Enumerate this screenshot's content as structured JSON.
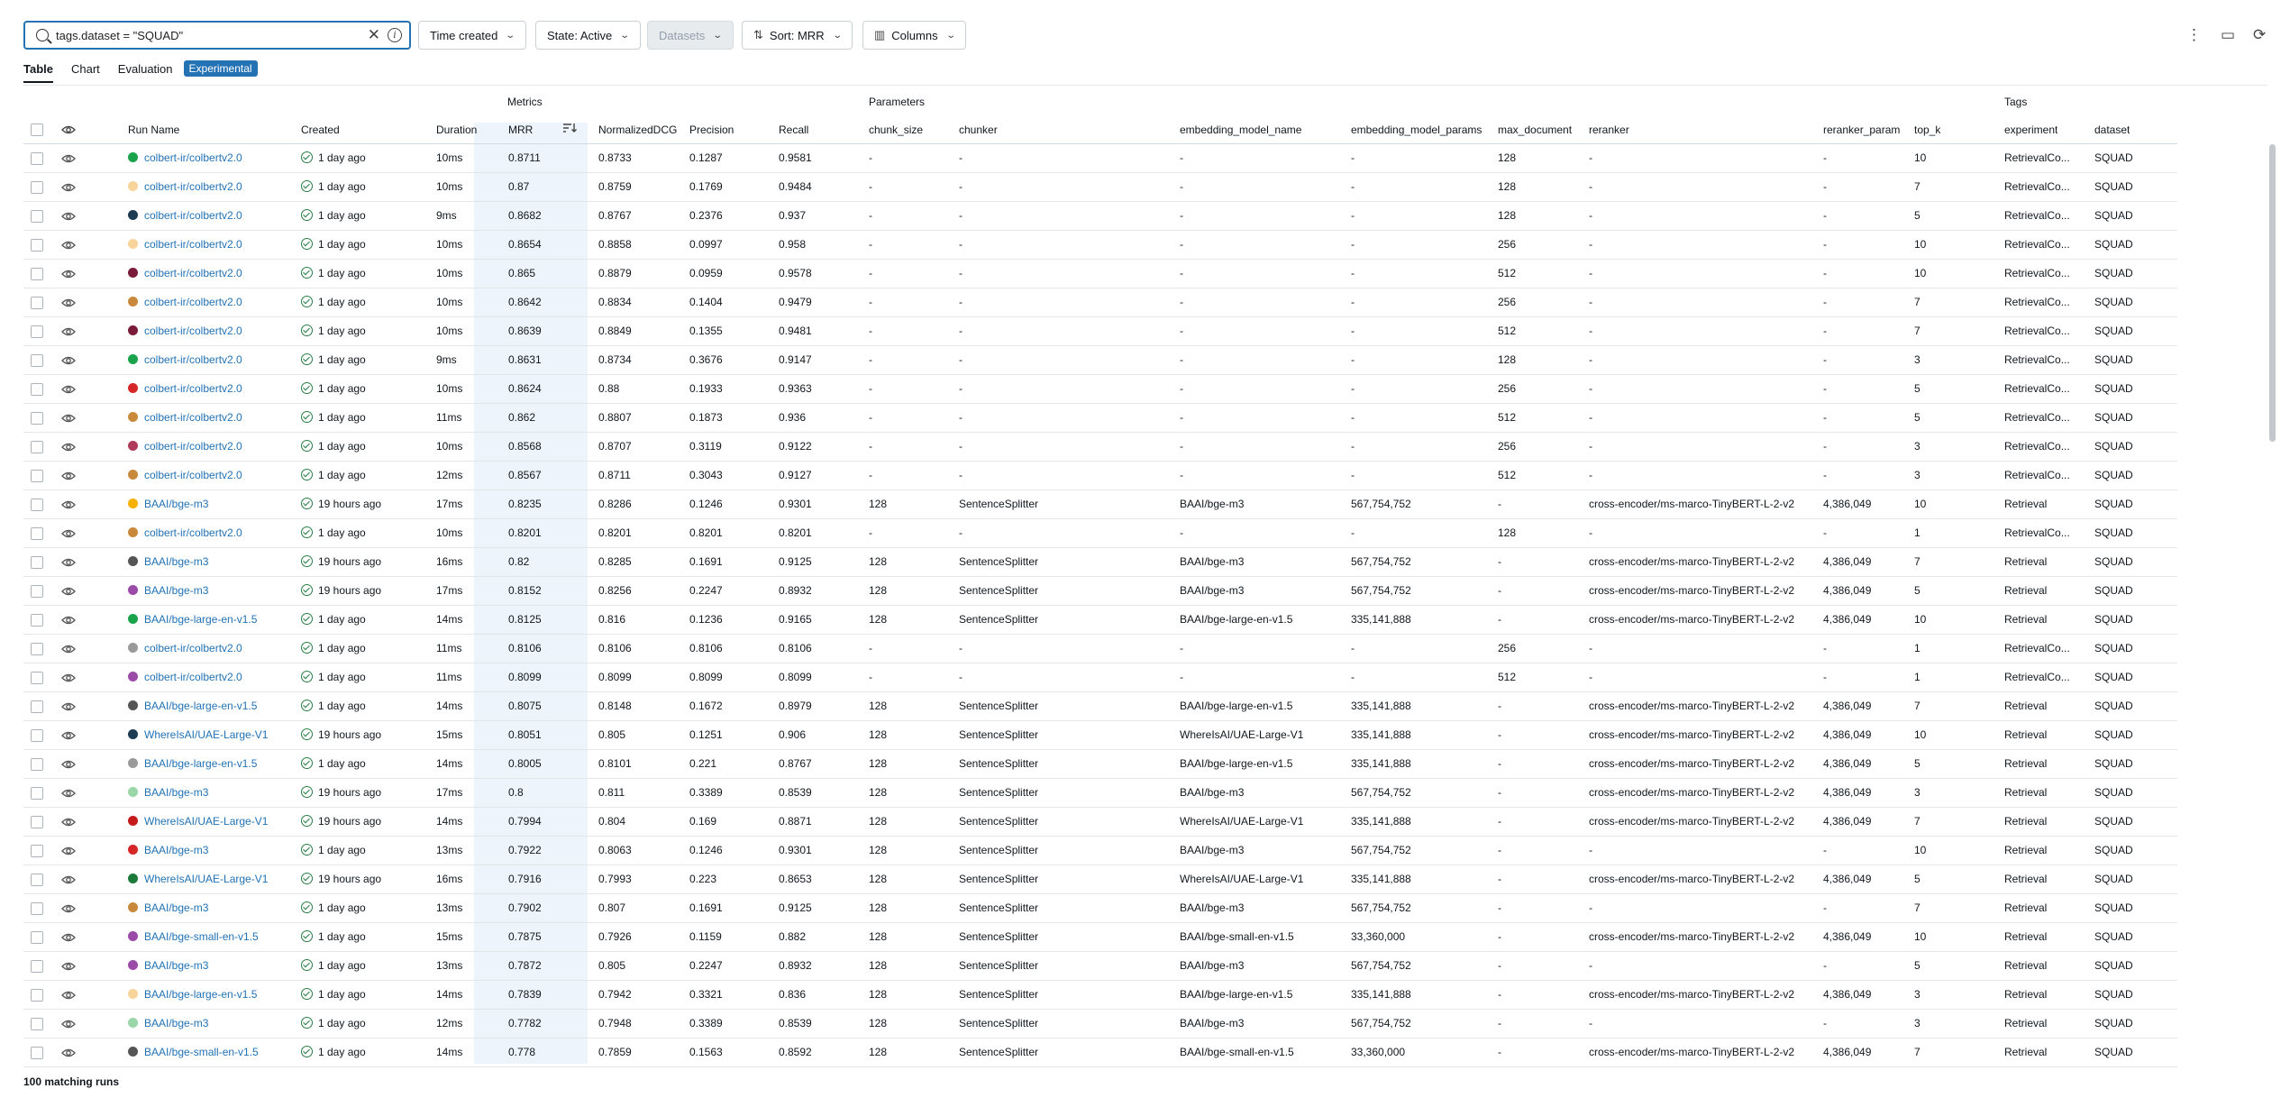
{
  "toolbar": {
    "search_value": "tags.dataset = \"SQUAD\"",
    "time_created": "Time created",
    "state": "State: Active",
    "datasets": "Datasets",
    "sort": "Sort: MRR",
    "columns": "Columns"
  },
  "tabs": {
    "table": "Table",
    "chart": "Chart",
    "evaluation": "Evaluation",
    "experimental": "Experimental"
  },
  "groups": {
    "metrics": "Metrics",
    "parameters": "Parameters",
    "tags": "Tags"
  },
  "columns": {
    "run_name": "Run Name",
    "created": "Created",
    "duration": "Duration",
    "mrr": "MRR",
    "ndcg": "NormalizedDCG",
    "precision": "Precision",
    "recall": "Recall",
    "chunk_size": "chunk_size",
    "chunker": "chunker",
    "embedding_model_name": "embedding_model_name",
    "embedding_model_params": "embedding_model_params",
    "max_document": "max_document",
    "reranker": "reranker",
    "reranker_param": "reranker_param",
    "top_k": "top_k",
    "experiment": "experiment",
    "dataset": "dataset"
  },
  "colors": {
    "link": "#2272b4",
    "success": "#277c43"
  },
  "rows": [
    {
      "color": "#1aa34a",
      "run": "colbert-ir/colbertv2.0",
      "created": "1 day ago",
      "duration": "10ms",
      "mrr": "0.8711",
      "ndcg": "0.8733",
      "precision": "0.1287",
      "recall": "0.9581",
      "chunk_size": "-",
      "chunker": "-",
      "emb_name": "-",
      "emb_params": "-",
      "max_doc": "128",
      "reranker": "-",
      "rr_param": "-",
      "top_k": "10",
      "experiment": "RetrievalCo...",
      "dataset": "SQUAD"
    },
    {
      "color": "#f8d49a",
      "run": "colbert-ir/colbertv2.0",
      "created": "1 day ago",
      "duration": "10ms",
      "mrr": "0.87",
      "ndcg": "0.8759",
      "precision": "0.1769",
      "recall": "0.9484",
      "chunk_size": "-",
      "chunker": "-",
      "emb_name": "-",
      "emb_params": "-",
      "max_doc": "128",
      "reranker": "-",
      "rr_param": "-",
      "top_k": "7",
      "experiment": "RetrievalCo...",
      "dataset": "SQUAD"
    },
    {
      "color": "#1d3b52",
      "run": "colbert-ir/colbertv2.0",
      "created": "1 day ago",
      "duration": "9ms",
      "mrr": "0.8682",
      "ndcg": "0.8767",
      "precision": "0.2376",
      "recall": "0.937",
      "chunk_size": "-",
      "chunker": "-",
      "emb_name": "-",
      "emb_params": "-",
      "max_doc": "128",
      "reranker": "-",
      "rr_param": "-",
      "top_k": "5",
      "experiment": "RetrievalCo...",
      "dataset": "SQUAD"
    },
    {
      "color": "#f8d49a",
      "run": "colbert-ir/colbertv2.0",
      "created": "1 day ago",
      "duration": "10ms",
      "mrr": "0.8654",
      "ndcg": "0.8858",
      "precision": "0.0997",
      "recall": "0.958",
      "chunk_size": "-",
      "chunker": "-",
      "emb_name": "-",
      "emb_params": "-",
      "max_doc": "256",
      "reranker": "-",
      "rr_param": "-",
      "top_k": "10",
      "experiment": "RetrievalCo...",
      "dataset": "SQUAD"
    },
    {
      "color": "#7a1b3a",
      "run": "colbert-ir/colbertv2.0",
      "created": "1 day ago",
      "duration": "10ms",
      "mrr": "0.865",
      "ndcg": "0.8879",
      "precision": "0.0959",
      "recall": "0.9578",
      "chunk_size": "-",
      "chunker": "-",
      "emb_name": "-",
      "emb_params": "-",
      "max_doc": "512",
      "reranker": "-",
      "rr_param": "-",
      "top_k": "10",
      "experiment": "RetrievalCo...",
      "dataset": "SQUAD"
    },
    {
      "color": "#c88a3a",
      "run": "colbert-ir/colbertv2.0",
      "created": "1 day ago",
      "duration": "10ms",
      "mrr": "0.8642",
      "ndcg": "0.8834",
      "precision": "0.1404",
      "recall": "0.9479",
      "chunk_size": "-",
      "chunker": "-",
      "emb_name": "-",
      "emb_params": "-",
      "max_doc": "256",
      "reranker": "-",
      "rr_param": "-",
      "top_k": "7",
      "experiment": "RetrievalCo...",
      "dataset": "SQUAD"
    },
    {
      "color": "#7a1b3a",
      "run": "colbert-ir/colbertv2.0",
      "created": "1 day ago",
      "duration": "10ms",
      "mrr": "0.8639",
      "ndcg": "0.8849",
      "precision": "0.1355",
      "recall": "0.9481",
      "chunk_size": "-",
      "chunker": "-",
      "emb_name": "-",
      "emb_params": "-",
      "max_doc": "512",
      "reranker": "-",
      "rr_param": "-",
      "top_k": "7",
      "experiment": "RetrievalCo...",
      "dataset": "SQUAD"
    },
    {
      "color": "#1aa34a",
      "run": "colbert-ir/colbertv2.0",
      "created": "1 day ago",
      "duration": "9ms",
      "mrr": "0.8631",
      "ndcg": "0.8734",
      "precision": "0.3676",
      "recall": "0.9147",
      "chunk_size": "-",
      "chunker": "-",
      "emb_name": "-",
      "emb_params": "-",
      "max_doc": "128",
      "reranker": "-",
      "rr_param": "-",
      "top_k": "3",
      "experiment": "RetrievalCo...",
      "dataset": "SQUAD"
    },
    {
      "color": "#d62728",
      "run": "colbert-ir/colbertv2.0",
      "created": "1 day ago",
      "duration": "10ms",
      "mrr": "0.8624",
      "ndcg": "0.88",
      "precision": "0.1933",
      "recall": "0.9363",
      "chunk_size": "-",
      "chunker": "-",
      "emb_name": "-",
      "emb_params": "-",
      "max_doc": "256",
      "reranker": "-",
      "rr_param": "-",
      "top_k": "5",
      "experiment": "RetrievalCo...",
      "dataset": "SQUAD"
    },
    {
      "color": "#c88a3a",
      "run": "colbert-ir/colbertv2.0",
      "created": "1 day ago",
      "duration": "11ms",
      "mrr": "0.862",
      "ndcg": "0.8807",
      "precision": "0.1873",
      "recall": "0.936",
      "chunk_size": "-",
      "chunker": "-",
      "emb_name": "-",
      "emb_params": "-",
      "max_doc": "512",
      "reranker": "-",
      "rr_param": "-",
      "top_k": "5",
      "experiment": "RetrievalCo...",
      "dataset": "SQUAD"
    },
    {
      "color": "#b03a5a",
      "run": "colbert-ir/colbertv2.0",
      "created": "1 day ago",
      "duration": "10ms",
      "mrr": "0.8568",
      "ndcg": "0.8707",
      "precision": "0.3119",
      "recall": "0.9122",
      "chunk_size": "-",
      "chunker": "-",
      "emb_name": "-",
      "emb_params": "-",
      "max_doc": "256",
      "reranker": "-",
      "rr_param": "-",
      "top_k": "3",
      "experiment": "RetrievalCo...",
      "dataset": "SQUAD"
    },
    {
      "color": "#c88a3a",
      "run": "colbert-ir/colbertv2.0",
      "created": "1 day ago",
      "duration": "12ms",
      "mrr": "0.8567",
      "ndcg": "0.8711",
      "precision": "0.3043",
      "recall": "0.9127",
      "chunk_size": "-",
      "chunker": "-",
      "emb_name": "-",
      "emb_params": "-",
      "max_doc": "512",
      "reranker": "-",
      "rr_param": "-",
      "top_k": "3",
      "experiment": "RetrievalCo...",
      "dataset": "SQUAD"
    },
    {
      "color": "#f5b000",
      "run": "BAAI/bge-m3",
      "created": "19 hours ago",
      "duration": "17ms",
      "mrr": "0.8235",
      "ndcg": "0.8286",
      "precision": "0.1246",
      "recall": "0.9301",
      "chunk_size": "128",
      "chunker": "SentenceSplitter",
      "emb_name": "BAAI/bge-m3",
      "emb_params": "567,754,752",
      "max_doc": "-",
      "reranker": "cross-encoder/ms-marco-TinyBERT-L-2-v2",
      "rr_param": "4,386,049",
      "top_k": "10",
      "experiment": "Retrieval",
      "dataset": "SQUAD"
    },
    {
      "color": "#c88a3a",
      "run": "colbert-ir/colbertv2.0",
      "created": "1 day ago",
      "duration": "10ms",
      "mrr": "0.8201",
      "ndcg": "0.8201",
      "precision": "0.8201",
      "recall": "0.8201",
      "chunk_size": "-",
      "chunker": "-",
      "emb_name": "-",
      "emb_params": "-",
      "max_doc": "128",
      "reranker": "-",
      "rr_param": "-",
      "top_k": "1",
      "experiment": "RetrievalCo...",
      "dataset": "SQUAD"
    },
    {
      "color": "#555555",
      "run": "BAAI/bge-m3",
      "created": "19 hours ago",
      "duration": "16ms",
      "mrr": "0.82",
      "ndcg": "0.8285",
      "precision": "0.1691",
      "recall": "0.9125",
      "chunk_size": "128",
      "chunker": "SentenceSplitter",
      "emb_name": "BAAI/bge-m3",
      "emb_params": "567,754,752",
      "max_doc": "-",
      "reranker": "cross-encoder/ms-marco-TinyBERT-L-2-v2",
      "rr_param": "4,386,049",
      "top_k": "7",
      "experiment": "Retrieval",
      "dataset": "SQUAD"
    },
    {
      "color": "#9b4aa8",
      "run": "BAAI/bge-m3",
      "created": "19 hours ago",
      "duration": "17ms",
      "mrr": "0.8152",
      "ndcg": "0.8256",
      "precision": "0.2247",
      "recall": "0.8932",
      "chunk_size": "128",
      "chunker": "SentenceSplitter",
      "emb_name": "BAAI/bge-m3",
      "emb_params": "567,754,752",
      "max_doc": "-",
      "reranker": "cross-encoder/ms-marco-TinyBERT-L-2-v2",
      "rr_param": "4,386,049",
      "top_k": "5",
      "experiment": "Retrieval",
      "dataset": "SQUAD"
    },
    {
      "color": "#1aa34a",
      "run": "BAAI/bge-large-en-v1.5",
      "created": "1 day ago",
      "duration": "14ms",
      "mrr": "0.8125",
      "ndcg": "0.816",
      "precision": "0.1236",
      "recall": "0.9165",
      "chunk_size": "128",
      "chunker": "SentenceSplitter",
      "emb_name": "BAAI/bge-large-en-v1.5",
      "emb_params": "335,141,888",
      "max_doc": "-",
      "reranker": "cross-encoder/ms-marco-TinyBERT-L-2-v2",
      "rr_param": "4,386,049",
      "top_k": "10",
      "experiment": "Retrieval",
      "dataset": "SQUAD"
    },
    {
      "color": "#9a9a9a",
      "run": "colbert-ir/colbertv2.0",
      "created": "1 day ago",
      "duration": "11ms",
      "mrr": "0.8106",
      "ndcg": "0.8106",
      "precision": "0.8106",
      "recall": "0.8106",
      "chunk_size": "-",
      "chunker": "-",
      "emb_name": "-",
      "emb_params": "-",
      "max_doc": "256",
      "reranker": "-",
      "rr_param": "-",
      "top_k": "1",
      "experiment": "RetrievalCo...",
      "dataset": "SQUAD"
    },
    {
      "color": "#9b4aa8",
      "run": "colbert-ir/colbertv2.0",
      "created": "1 day ago",
      "duration": "11ms",
      "mrr": "0.8099",
      "ndcg": "0.8099",
      "precision": "0.8099",
      "recall": "0.8099",
      "chunk_size": "-",
      "chunker": "-",
      "emb_name": "-",
      "emb_params": "-",
      "max_doc": "512",
      "reranker": "-",
      "rr_param": "-",
      "top_k": "1",
      "experiment": "RetrievalCo...",
      "dataset": "SQUAD"
    },
    {
      "color": "#555555",
      "run": "BAAI/bge-large-en-v1.5",
      "created": "1 day ago",
      "duration": "14ms",
      "mrr": "0.8075",
      "ndcg": "0.8148",
      "precision": "0.1672",
      "recall": "0.8979",
      "chunk_size": "128",
      "chunker": "SentenceSplitter",
      "emb_name": "BAAI/bge-large-en-v1.5",
      "emb_params": "335,141,888",
      "max_doc": "-",
      "reranker": "cross-encoder/ms-marco-TinyBERT-L-2-v2",
      "rr_param": "4,386,049",
      "top_k": "7",
      "experiment": "Retrieval",
      "dataset": "SQUAD"
    },
    {
      "color": "#1d3b52",
      "run": "WhereIsAI/UAE-Large-V1",
      "created": "19 hours ago",
      "duration": "15ms",
      "mrr": "0.8051",
      "ndcg": "0.805",
      "precision": "0.1251",
      "recall": "0.906",
      "chunk_size": "128",
      "chunker": "SentenceSplitter",
      "emb_name": "WhereIsAI/UAE-Large-V1",
      "emb_params": "335,141,888",
      "max_doc": "-",
      "reranker": "cross-encoder/ms-marco-TinyBERT-L-2-v2",
      "rr_param": "4,386,049",
      "top_k": "10",
      "experiment": "Retrieval",
      "dataset": "SQUAD"
    },
    {
      "color": "#9a9a9a",
      "run": "BAAI/bge-large-en-v1.5",
      "created": "1 day ago",
      "duration": "14ms",
      "mrr": "0.8005",
      "ndcg": "0.8101",
      "precision": "0.221",
      "recall": "0.8767",
      "chunk_size": "128",
      "chunker": "SentenceSplitter",
      "emb_name": "BAAI/bge-large-en-v1.5",
      "emb_params": "335,141,888",
      "max_doc": "-",
      "reranker": "cross-encoder/ms-marco-TinyBERT-L-2-v2",
      "rr_param": "4,386,049",
      "top_k": "5",
      "experiment": "Retrieval",
      "dataset": "SQUAD"
    },
    {
      "color": "#9ad6a8",
      "run": "BAAI/bge-m3",
      "created": "19 hours ago",
      "duration": "17ms",
      "mrr": "0.8",
      "ndcg": "0.811",
      "precision": "0.3389",
      "recall": "0.8539",
      "chunk_size": "128",
      "chunker": "SentenceSplitter",
      "emb_name": "BAAI/bge-m3",
      "emb_params": "567,754,752",
      "max_doc": "-",
      "reranker": "cross-encoder/ms-marco-TinyBERT-L-2-v2",
      "rr_param": "4,386,049",
      "top_k": "3",
      "experiment": "Retrieval",
      "dataset": "SQUAD"
    },
    {
      "color": "#c41a1a",
      "run": "WhereIsAI/UAE-Large-V1",
      "created": "19 hours ago",
      "duration": "14ms",
      "mrr": "0.7994",
      "ndcg": "0.804",
      "precision": "0.169",
      "recall": "0.8871",
      "chunk_size": "128",
      "chunker": "SentenceSplitter",
      "emb_name": "WhereIsAI/UAE-Large-V1",
      "emb_params": "335,141,888",
      "max_doc": "-",
      "reranker": "cross-encoder/ms-marco-TinyBERT-L-2-v2",
      "rr_param": "4,386,049",
      "top_k": "7",
      "experiment": "Retrieval",
      "dataset": "SQUAD"
    },
    {
      "color": "#d62728",
      "run": "BAAI/bge-m3",
      "created": "1 day ago",
      "duration": "13ms",
      "mrr": "0.7922",
      "ndcg": "0.8063",
      "precision": "0.1246",
      "recall": "0.9301",
      "chunk_size": "128",
      "chunker": "SentenceSplitter",
      "emb_name": "BAAI/bge-m3",
      "emb_params": "567,754,752",
      "max_doc": "-",
      "reranker": "-",
      "rr_param": "-",
      "top_k": "10",
      "experiment": "Retrieval",
      "dataset": "SQUAD"
    },
    {
      "color": "#1a7a3a",
      "run": "WhereIsAI/UAE-Large-V1",
      "created": "19 hours ago",
      "duration": "16ms",
      "mrr": "0.7916",
      "ndcg": "0.7993",
      "precision": "0.223",
      "recall": "0.8653",
      "chunk_size": "128",
      "chunker": "SentenceSplitter",
      "emb_name": "WhereIsAI/UAE-Large-V1",
      "emb_params": "335,141,888",
      "max_doc": "-",
      "reranker": "cross-encoder/ms-marco-TinyBERT-L-2-v2",
      "rr_param": "4,386,049",
      "top_k": "5",
      "experiment": "Retrieval",
      "dataset": "SQUAD"
    },
    {
      "color": "#c88a3a",
      "run": "BAAI/bge-m3",
      "created": "1 day ago",
      "duration": "13ms",
      "mrr": "0.7902",
      "ndcg": "0.807",
      "precision": "0.1691",
      "recall": "0.9125",
      "chunk_size": "128",
      "chunker": "SentenceSplitter",
      "emb_name": "BAAI/bge-m3",
      "emb_params": "567,754,752",
      "max_doc": "-",
      "reranker": "-",
      "rr_param": "-",
      "top_k": "7",
      "experiment": "Retrieval",
      "dataset": "SQUAD"
    },
    {
      "color": "#9b4aa8",
      "run": "BAAI/bge-small-en-v1.5",
      "created": "1 day ago",
      "duration": "15ms",
      "mrr": "0.7875",
      "ndcg": "0.7926",
      "precision": "0.1159",
      "recall": "0.882",
      "chunk_size": "128",
      "chunker": "SentenceSplitter",
      "emb_name": "BAAI/bge-small-en-v1.5",
      "emb_params": "33,360,000",
      "max_doc": "-",
      "reranker": "cross-encoder/ms-marco-TinyBERT-L-2-v2",
      "rr_param": "4,386,049",
      "top_k": "10",
      "experiment": "Retrieval",
      "dataset": "SQUAD"
    },
    {
      "color": "#9b4aa8",
      "run": "BAAI/bge-m3",
      "created": "1 day ago",
      "duration": "13ms",
      "mrr": "0.7872",
      "ndcg": "0.805",
      "precision": "0.2247",
      "recall": "0.8932",
      "chunk_size": "128",
      "chunker": "SentenceSplitter",
      "emb_name": "BAAI/bge-m3",
      "emb_params": "567,754,752",
      "max_doc": "-",
      "reranker": "-",
      "rr_param": "-",
      "top_k": "5",
      "experiment": "Retrieval",
      "dataset": "SQUAD"
    },
    {
      "color": "#f8d49a",
      "run": "BAAI/bge-large-en-v1.5",
      "created": "1 day ago",
      "duration": "14ms",
      "mrr": "0.7839",
      "ndcg": "0.7942",
      "precision": "0.3321",
      "recall": "0.836",
      "chunk_size": "128",
      "chunker": "SentenceSplitter",
      "emb_name": "BAAI/bge-large-en-v1.5",
      "emb_params": "335,141,888",
      "max_doc": "-",
      "reranker": "cross-encoder/ms-marco-TinyBERT-L-2-v2",
      "rr_param": "4,386,049",
      "top_k": "3",
      "experiment": "Retrieval",
      "dataset": "SQUAD"
    },
    {
      "color": "#9ad6a8",
      "run": "BAAI/bge-m3",
      "created": "1 day ago",
      "duration": "12ms",
      "mrr": "0.7782",
      "ndcg": "0.7948",
      "precision": "0.3389",
      "recall": "0.8539",
      "chunk_size": "128",
      "chunker": "SentenceSplitter",
      "emb_name": "BAAI/bge-m3",
      "emb_params": "567,754,752",
      "max_doc": "-",
      "reranker": "-",
      "rr_param": "-",
      "top_k": "3",
      "experiment": "Retrieval",
      "dataset": "SQUAD"
    },
    {
      "color": "#555555",
      "run": "BAAI/bge-small-en-v1.5",
      "created": "1 day ago",
      "duration": "14ms",
      "mrr": "0.778",
      "ndcg": "0.7859",
      "precision": "0.1563",
      "recall": "0.8592",
      "chunk_size": "128",
      "chunker": "SentenceSplitter",
      "emb_name": "BAAI/bge-small-en-v1.5",
      "emb_params": "33,360,000",
      "max_doc": "-",
      "reranker": "cross-encoder/ms-marco-TinyBERT-L-2-v2",
      "rr_param": "4,386,049",
      "top_k": "7",
      "experiment": "Retrieval",
      "dataset": "SQUAD"
    }
  ],
  "footer": "100 matching runs"
}
